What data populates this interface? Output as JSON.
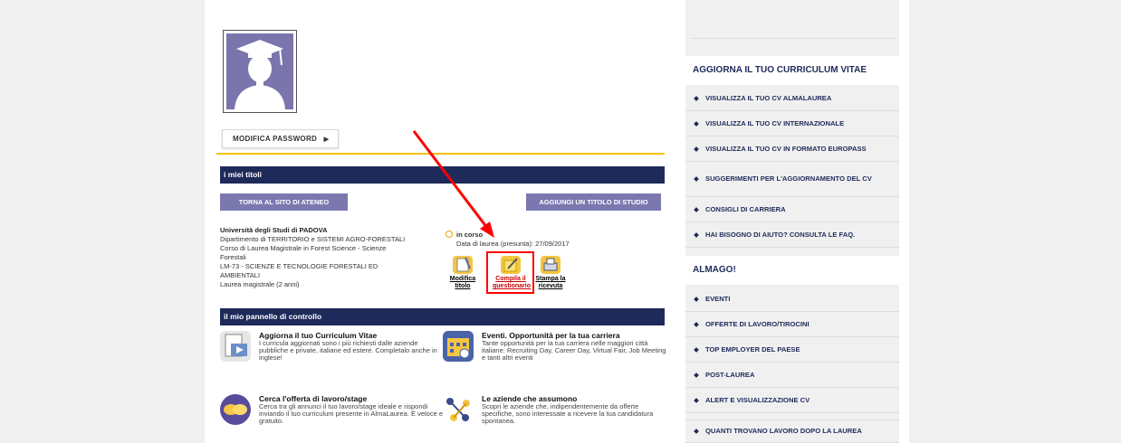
{
  "profile": {
    "change_password_label": "MODIFICA PASSWORD",
    "change_password_icon": "caret-right-icon"
  },
  "titles_section": {
    "header": "i miei titoli",
    "back_button": "TORNA AL SITO DI ATENEO",
    "add_button": "AGGIUNGI UN TITOLO DI STUDIO"
  },
  "degree": {
    "university": "Università degli Studi di PADOVA",
    "department": "Dipartimento di TERRITORIO e SISTEMI AGRO-FORESTALI",
    "course_line1": "Corso di Laurea Magistrale in Forest Science - Scienze",
    "course_line2": "Forestali",
    "class_line1": "LM-73 - SCIENZE E TECNOLOGIE FORESTALI ED",
    "class_line2": "AMBIENTALI",
    "type": "Laurea magistrale (2 anni)",
    "status": "in corso",
    "graduation_date": "Data di laurea (presunta): 27/09/2017",
    "actions": [
      {
        "line1": "Modifica",
        "line2": "titolo",
        "icon": "edit-document-icon",
        "color": "#000000"
      },
      {
        "line1": "Compila il",
        "line2": "questionario",
        "icon": "questionnaire-pencil-icon",
        "color": "#cc0000"
      },
      {
        "line1": "Stampa la",
        "line2": "ricevuta",
        "icon": "printer-icon",
        "color": "#000000"
      }
    ]
  },
  "control_panel": {
    "header": "il mio pannello di controllo",
    "panels": [
      {
        "title": "Aggiorna il tuo Curriculum Vitae",
        "description": "I curricula aggiornati sono i più richiesti dalle aziende pubbliche e private, italiane ed estere. Completalo anche in inglese!",
        "icon": "cv-document-icon"
      },
      {
        "title": "Eventi. Opportunità per la tua carriera",
        "description": "Tante opportunità per la tua carriera nelle maggiori città italiane. Recruiting Day, Career Day, Virtual Fair, Job Meeting e tanti altri eventi",
        "icon": "calendar-icon"
      },
      {
        "title": "Cerca l'offerta di lavoro/stage",
        "description": "Cerca tra gli annunci il tuo lavoro/stage ideale e rispondi inviando il tuo curriculum presente in AlmaLaurea. È veloce e gratuito.",
        "icon": "handshake-icon"
      },
      {
        "title": "Le aziende che assumono",
        "description": "Scopri le aziende che, indipendentemente da offerte specifiche, sono interessate a ricevere la tua candidatura spontanea.",
        "icon": "people-network-icon"
      }
    ]
  },
  "sidebar": {
    "cv_section_title": "AGGIORNA IL TUO CURRICULUM VITAE",
    "cv_items": [
      "VISUALIZZA IL TUO CV ALMALAUREA",
      "VISUALIZZA IL TUO CV INTERNAZIONALE",
      "VISUALIZZA IL TUO CV IN FORMATO EUROPASS",
      "SUGGERIMENTI PER L'AGGIORNAMENTO DEL CV",
      "CONSIGLI DI CARRIERA",
      "HAI BISOGNO DI AIUTO? CONSULTA LE FAQ."
    ],
    "almago_section_title": "ALMAGO!",
    "almago_items": [
      "EVENTI",
      "OFFERTE DI LAVORO/TIROCINI",
      "TOP EMPLOYER DEL PAESE",
      "POST-LAUREA",
      "ALERT E VISUALIZZAZIONE CV",
      "QUANTI TROVANO LAVORO DOPO LA LAUREA"
    ]
  },
  "colors": {
    "navy": "#1e2a5a",
    "purple_button": "#7b78b0",
    "gold_line": "#f2c200",
    "annotation_red": "#ff0000"
  }
}
